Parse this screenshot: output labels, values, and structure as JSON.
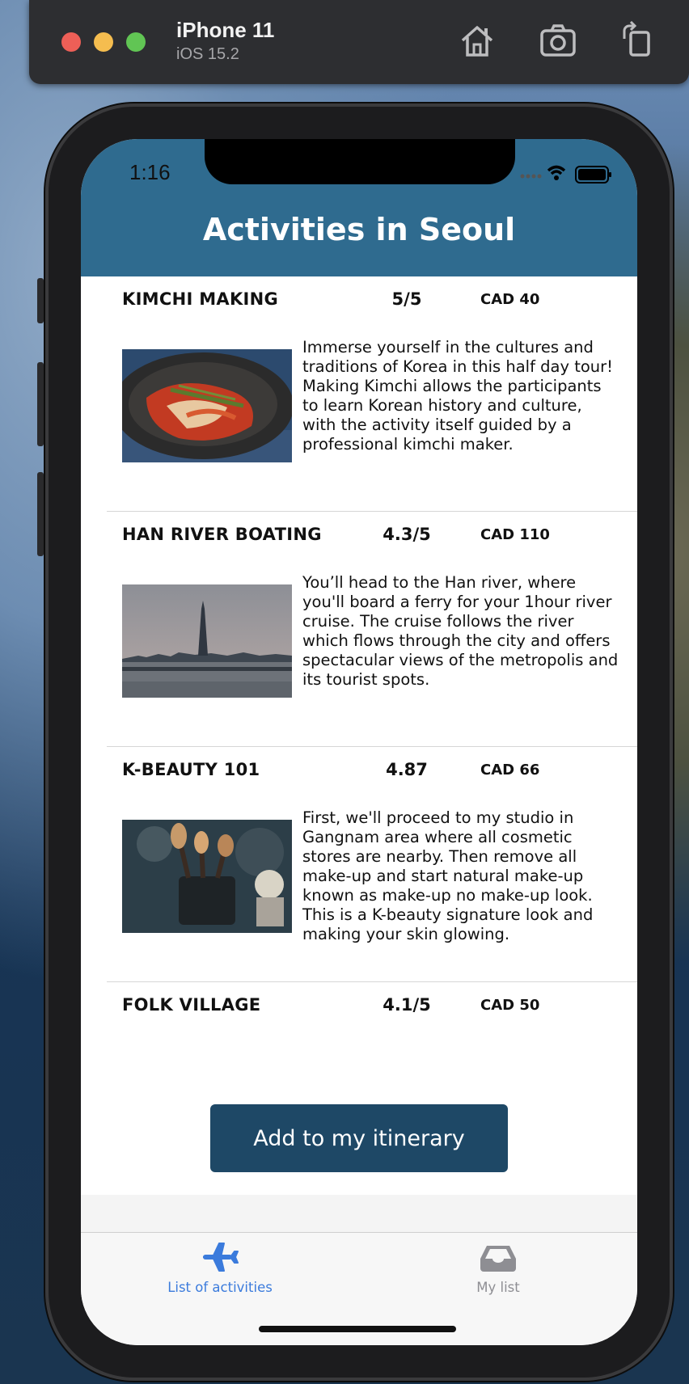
{
  "simulator": {
    "device_name": "iPhone 11",
    "os_version": "iOS 15.2",
    "tools": [
      "home-icon",
      "screenshot-camera-icon",
      "rotate-icon"
    ]
  },
  "status_bar": {
    "time": "1:16"
  },
  "header": {
    "title": "Activities in Seoul",
    "color": "#2f6b8f"
  },
  "activities": [
    {
      "name": "KIMCHI MAKING",
      "rating": "5/5",
      "price": "CAD 40",
      "image": "kimchi-bowl-photo",
      "description": "Immerse yourself in the cultures and traditions of Korea in this half day tour!  Making Kimchi allows the participants to learn Korean history and culture, with the activity itself guided by a professional kimchi maker."
    },
    {
      "name": "HAN RIVER BOATING",
      "rating": "4.3/5",
      "price": "CAD 110",
      "image": "han-river-skyline-photo",
      "description": "You’ll head to the Han river, where you'll board a ferry for your 1hour river cruise. The cruise follows the river which flows through the city and offers spectacular views of the metropolis and its tourist spots."
    },
    {
      "name": "K-BEAUTY 101",
      "rating": "4.87",
      "price": "CAD 66",
      "image": "makeup-brushes-photo",
      "description": "First, we'll proceed to my studio in Gangnam area where all cosmetic stores are nearby. Then remove all make-up and start natural make-up known as make-up no make-up look. This is a K-beauty signature look and making your skin glowing."
    },
    {
      "name": "FOLK VILLAGE",
      "rating": "4.1/5",
      "price": "CAD 50",
      "image": "folk-village-photo",
      "description": ""
    }
  ],
  "actions": {
    "add_itinerary_label": "Add to my itinerary",
    "button_color": "#1e4866"
  },
  "tab_bar": {
    "tabs": [
      {
        "label": "List of activities",
        "icon": "airplane-icon",
        "active": true,
        "color": "#3b7bdc"
      },
      {
        "label": "My list",
        "icon": "inbox-tray-icon",
        "active": false,
        "color": "#8e8e93"
      }
    ]
  }
}
